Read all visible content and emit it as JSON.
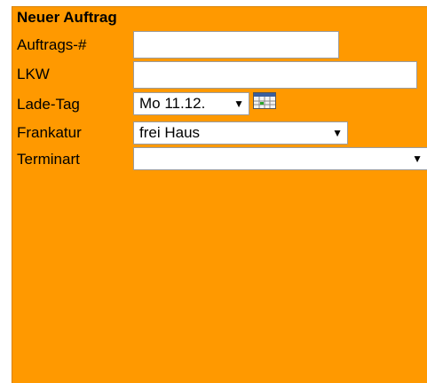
{
  "form": {
    "title": "Neuer Auftrag",
    "fields": [
      {
        "label": "Auftrags-#",
        "value": ""
      },
      {
        "label": "LKW",
        "value": ""
      },
      {
        "label": "Lade-Tag",
        "value": "Mo 11.12."
      },
      {
        "label": "Frankatur",
        "value": "frei Haus"
      },
      {
        "label": "Terminart",
        "value": ""
      }
    ]
  },
  "icons": {
    "calendar": "calendar-icon",
    "dropdown": "chevron-down-icon"
  },
  "colors": {
    "panel": "#ff9900",
    "field_bg": "#ffffff"
  }
}
